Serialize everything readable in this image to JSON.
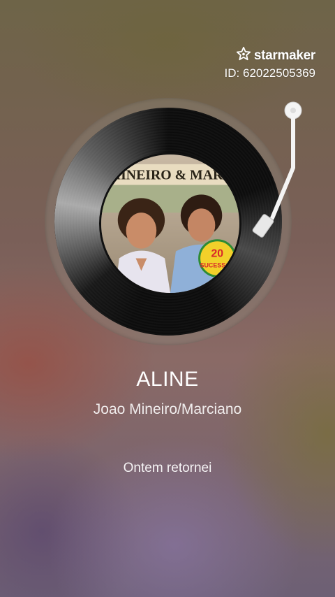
{
  "watermark": {
    "brand": "starmaker",
    "user_id": "ID: 62022505369",
    "icon": "starmaker-star-icon"
  },
  "player": {
    "cover_icon": "album-cover-art",
    "cover_text": {
      "banner": "MINEIRO & MARC",
      "badge_number": "20",
      "badge_word": "SUCESSOS"
    }
  },
  "song": {
    "title": "ALINE",
    "artist": "Joao Mineiro/Marciano",
    "lyric_line": "Ontem retornei"
  },
  "colors": {
    "accent_text": "#ffffff"
  }
}
